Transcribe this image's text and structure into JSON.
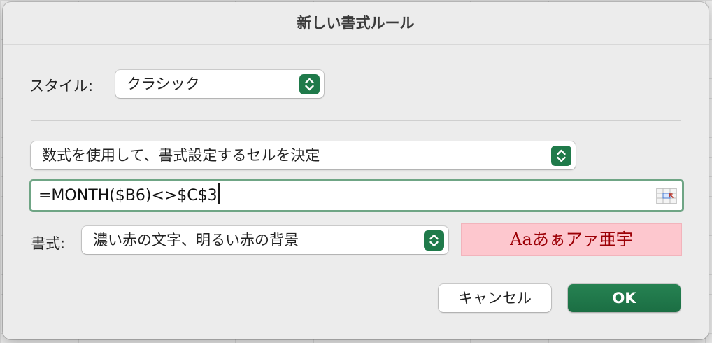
{
  "dialog": {
    "title": "新しい書式ルール"
  },
  "style_row": {
    "label": "スタイル:",
    "selected": "クラシック"
  },
  "rule_type": {
    "selected": "数式を使用して、書式設定するセルを決定"
  },
  "formula": {
    "value": "=MONTH($B6)<>$C$3"
  },
  "format_row": {
    "label": "書式:",
    "selected": "濃い赤の文字、明るい赤の背景",
    "preview_text": "Aaあぁアァ亜宇"
  },
  "buttons": {
    "cancel": "キャンセル",
    "ok": "OK"
  },
  "colors": {
    "accent_green": "#1f7a4a",
    "preview_bg": "#fdc7ce",
    "preview_text": "#9c0006",
    "focus_ring": "#6fa585"
  },
  "icons": {
    "popup_stepper": "chevron-up-down-icon",
    "collapse_dialog": "range-selector-icon"
  }
}
